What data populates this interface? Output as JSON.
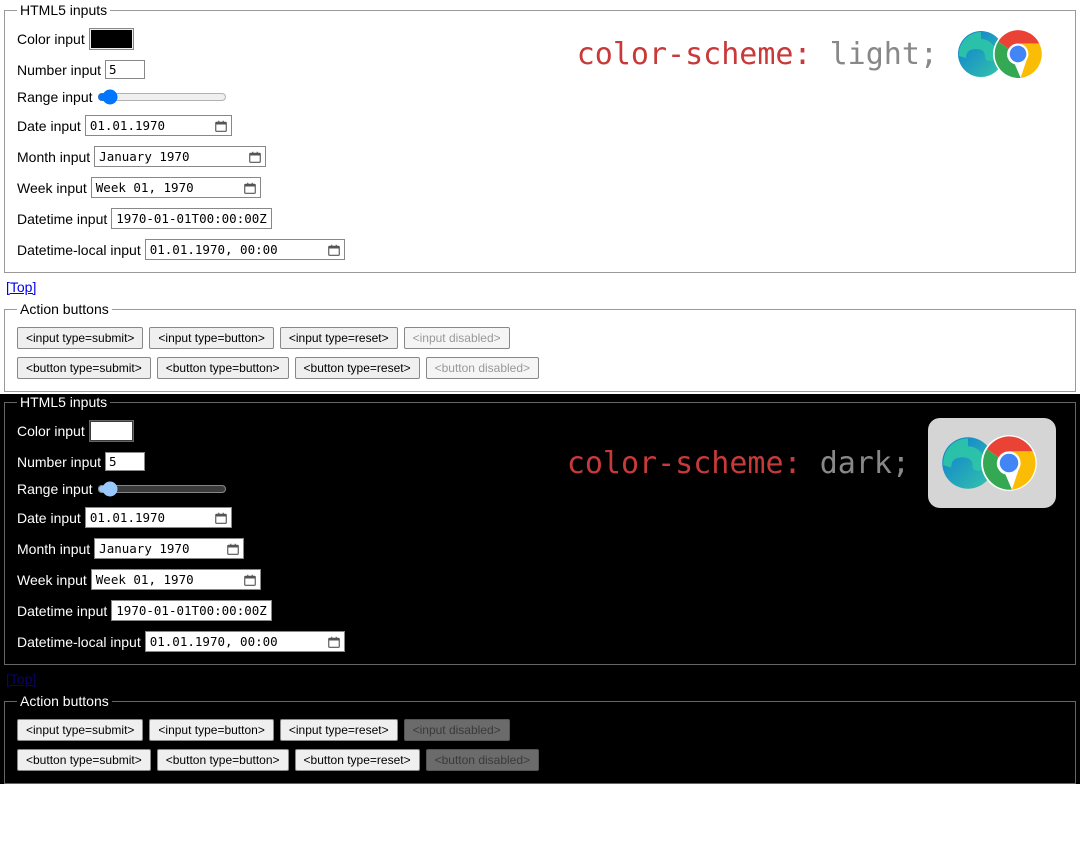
{
  "light": {
    "legend_inputs": "HTML5 inputs",
    "legend_actions": "Action buttons",
    "scheme_prop": "color-scheme:",
    "scheme_val": "light;",
    "labels": {
      "color": "Color input",
      "number": "Number input",
      "range": "Range input",
      "date": "Date input",
      "month": "Month input",
      "week": "Week input",
      "datetime": "Datetime input",
      "datetime_local": "Datetime-local input"
    },
    "values": {
      "number": "5",
      "date": "01.01.1970",
      "month": "January 1970",
      "week": "Week 01, 1970",
      "datetime": "1970-01-01T00:00:00Z",
      "datetime_local": "01.01.1970, 00:00"
    },
    "top_link": "[Top]",
    "buttons_row1": {
      "submit": "<input type=submit>",
      "button": "<input type=button>",
      "reset": "<input type=reset>",
      "disabled": "<input disabled>"
    },
    "buttons_row2": {
      "submit": "<button type=submit>",
      "button": "<button type=button>",
      "reset": "<button type=reset>",
      "disabled": "<button disabled>"
    }
  },
  "dark": {
    "legend_inputs": "HTML5 inputs",
    "legend_actions": "Action buttons",
    "scheme_prop": "color-scheme:",
    "scheme_val": "dark;",
    "labels": {
      "color": "Color input",
      "number": "Number input",
      "range": "Range input",
      "date": "Date input",
      "month": "Month input",
      "week": "Week input",
      "datetime": "Datetime input",
      "datetime_local": "Datetime-local input"
    },
    "values": {
      "number": "5",
      "date": "01.01.1970",
      "month": "January 1970",
      "week": "Week 01, 1970",
      "datetime": "1970-01-01T00:00:00Z",
      "datetime_local": "01.01.1970, 00:00"
    },
    "top_link": "[Top]",
    "buttons_row1": {
      "submit": "<input type=submit>",
      "button": "<input type=button>",
      "reset": "<input type=reset>",
      "disabled": "<input disabled>"
    },
    "buttons_row2": {
      "submit": "<button type=submit>",
      "button": "<button type=button>",
      "reset": "<button type=reset>",
      "disabled": "<button disabled>"
    }
  }
}
